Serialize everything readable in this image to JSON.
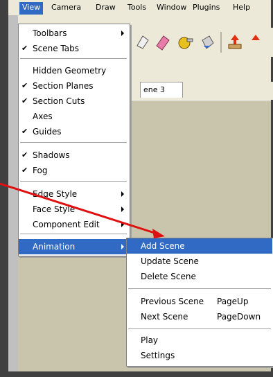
{
  "menubar": {
    "items": [
      {
        "label": "View",
        "active": true
      },
      {
        "label": "Camera"
      },
      {
        "label": "Draw"
      },
      {
        "label": "Tools"
      },
      {
        "label": "Window"
      },
      {
        "label": "Plugins"
      },
      {
        "label": "Help"
      }
    ]
  },
  "tabs": {
    "scene3": "ene 3"
  },
  "view_menu": {
    "items": [
      {
        "label": "Toolbars",
        "checked": false,
        "submenu": true
      },
      {
        "label": "Scene Tabs",
        "checked": true
      },
      {
        "label": "Hidden Geometry",
        "checked": false
      },
      {
        "label": "Section Planes",
        "checked": true
      },
      {
        "label": "Section Cuts",
        "checked": true
      },
      {
        "label": "Axes",
        "checked": false
      },
      {
        "label": "Guides",
        "checked": true
      },
      {
        "label": "Shadows",
        "checked": true
      },
      {
        "label": "Fog",
        "checked": true
      },
      {
        "label": "Edge Style",
        "checked": false,
        "submenu": true
      },
      {
        "label": "Face Style",
        "checked": false,
        "submenu": true
      },
      {
        "label": "Component Edit",
        "checked": false,
        "submenu": true
      },
      {
        "label": "Animation",
        "checked": false,
        "submenu": true,
        "highlighted": true
      }
    ]
  },
  "animation_menu": {
    "items": [
      {
        "label": "Add Scene",
        "highlighted": true
      },
      {
        "label": "Update Scene"
      },
      {
        "label": "Delete Scene"
      },
      {
        "label": "Previous Scene",
        "shortcut": "PageUp"
      },
      {
        "label": "Next Scene",
        "shortcut": "PageDown"
      },
      {
        "label": "Play"
      },
      {
        "label": "Settings"
      }
    ]
  },
  "check_glyph": "✔",
  "colors": {
    "highlight": "#316ac5",
    "annotation": "#e01010"
  }
}
